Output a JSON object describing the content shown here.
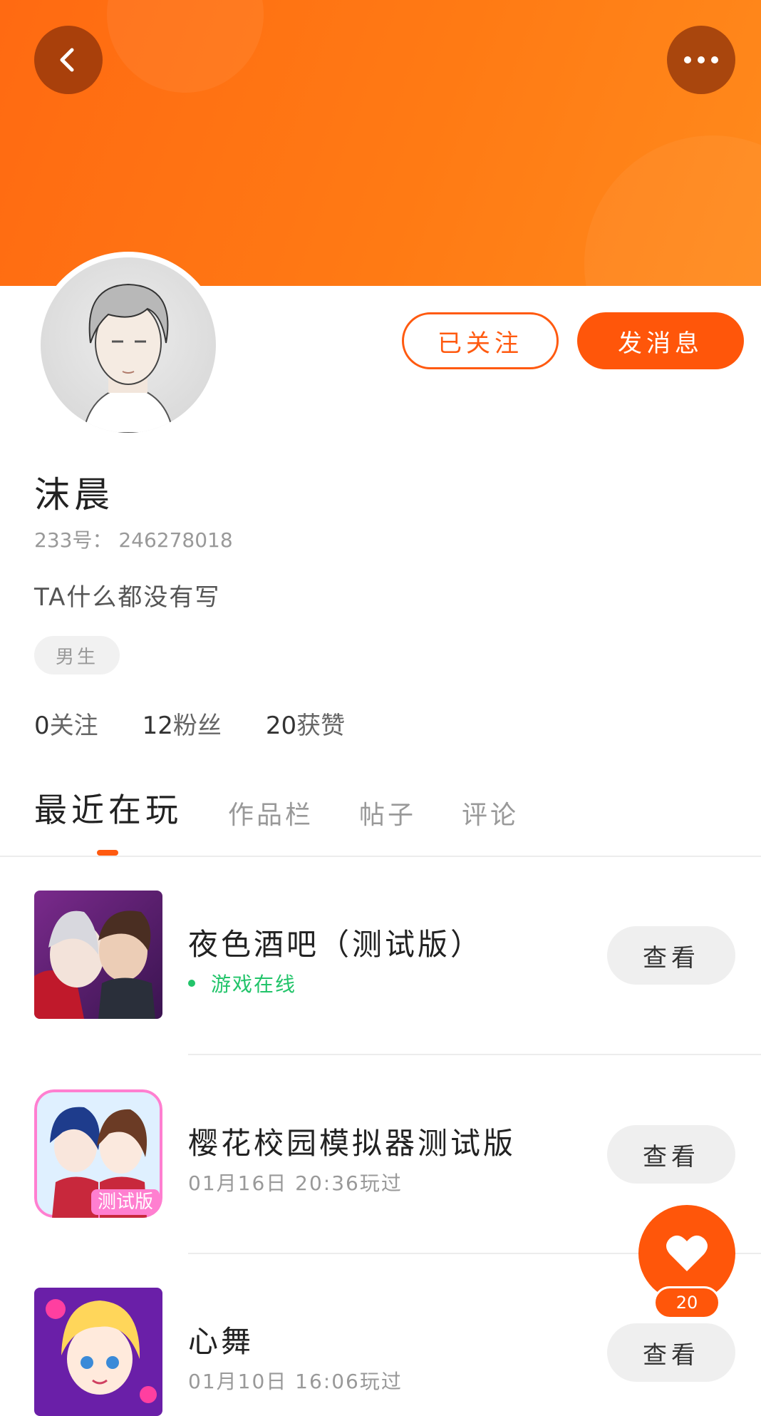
{
  "header": {
    "back_icon": "chevron-left-icon",
    "more_icon": "more-dots-icon",
    "gradient_colors": [
      "#ff6a12",
      "#ff8a1c"
    ]
  },
  "profile": {
    "name": "沫晨",
    "id_text": "233号： 246278018",
    "bio": "TA什么都没有写",
    "gender": "男生",
    "follow_button": "已关注",
    "message_button": "发消息"
  },
  "stats": [
    {
      "value": "0",
      "label": "关注"
    },
    {
      "value": "12",
      "label": "粉丝"
    },
    {
      "value": "20",
      "label": "获赞"
    }
  ],
  "tabs": [
    {
      "label": "最近在玩",
      "active": true
    },
    {
      "label": "作品栏",
      "active": false
    },
    {
      "label": "帖子",
      "active": false
    },
    {
      "label": "评论",
      "active": false
    }
  ],
  "games": [
    {
      "title": "夜色酒吧（测试版）",
      "subtitle": "游戏在线",
      "online": true,
      "button": "查看"
    },
    {
      "title": "樱花校园模拟器测试版",
      "subtitle": "01月16日 20:36玩过",
      "online": false,
      "button": "查看"
    },
    {
      "title": "心舞",
      "subtitle": "01月10日 16:06玩过",
      "online": false,
      "button": "查看"
    }
  ],
  "game2_badge": "测试版",
  "fab": {
    "icon": "heart-icon",
    "count": "20"
  },
  "colors": {
    "accent": "#ff560a",
    "online": "#22c46a"
  }
}
